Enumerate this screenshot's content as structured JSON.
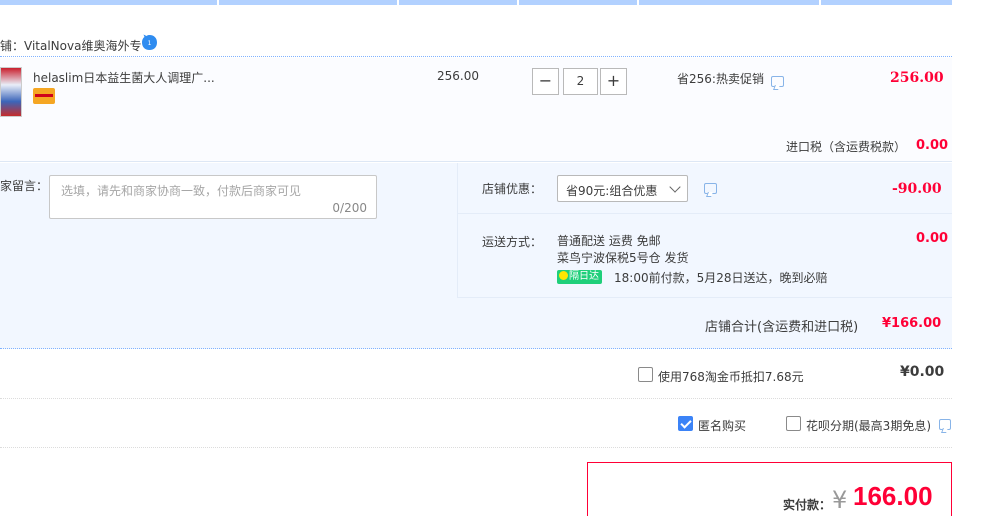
{
  "shop": {
    "name": "铺：VitalNova维奥海外专"
  },
  "item": {
    "title": "helaslim日本益生菌大人调理广...",
    "unit_price": "256.00",
    "quantity": "2",
    "qty_minus": "−",
    "qty_plus": "+",
    "promo": "省256:热卖促销",
    "total": "256.00"
  },
  "tax": {
    "label": "进口税（含运费税款）",
    "value": "0.00"
  },
  "message": {
    "label": "家留言：",
    "placeholder": "选填，请先和商家协商一致，付款后商家可见",
    "count": "0/200"
  },
  "discount": {
    "label": "店铺优惠：",
    "selected": "省90元:组合优惠",
    "value": "-90.00"
  },
  "shipping": {
    "label": "运送方式：",
    "line1": "普通配送 运费 免邮",
    "line2": "菜鸟宁波保税5号仓   发货",
    "badge": "隔日达",
    "line3": "18:00前付款，5月28日送达，晚到必赔",
    "value": "0.00"
  },
  "shop_total": {
    "label": "店铺合计(含运费和进口税)",
    "value": "¥166.00"
  },
  "coins": {
    "label": "使用768淘金币抵扣7.68元",
    "value": "¥0.00",
    "checked": false
  },
  "options": {
    "anonymous_label": "匿名购买",
    "anonymous_checked": true,
    "huabei_label": "花呗分期(最高3期免息)",
    "huabei_checked": false
  },
  "payment": {
    "label": "实付款：",
    "currency": "¥",
    "amount": "166.00"
  },
  "colors": {
    "price_red": "#ff0036",
    "accent_blue": "#3b83f7",
    "detail_bg": "#f2f7ff"
  }
}
